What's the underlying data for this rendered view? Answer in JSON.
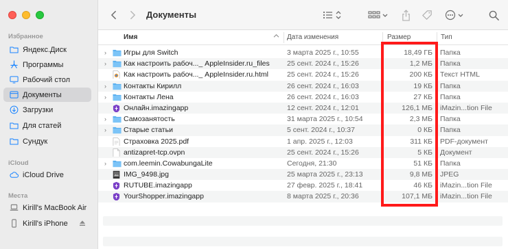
{
  "sidebar": {
    "favorites_label": "Избранное",
    "favorites": [
      {
        "label": "Яндекс.Диск",
        "icon": "folder-icon"
      },
      {
        "label": "Программы",
        "icon": "apps-icon"
      },
      {
        "label": "Рабочий стол",
        "icon": "desktop-icon"
      },
      {
        "label": "Документы",
        "icon": "document-icon",
        "selected": true
      },
      {
        "label": "Загрузки",
        "icon": "download-icon"
      },
      {
        "label": "Для статей",
        "icon": "folder-icon"
      },
      {
        "label": "Сундук",
        "icon": "folder-icon"
      }
    ],
    "icloud_label": "iCloud",
    "icloud": [
      {
        "label": "iCloud Drive",
        "icon": "cloud-icon"
      }
    ],
    "places_label": "Места",
    "places": [
      {
        "label": "Kirill's MacBook Air",
        "icon": "laptop-icon"
      },
      {
        "label": "Kirill's iPhone",
        "icon": "phone-icon"
      }
    ]
  },
  "toolbar": {
    "title": "Документы"
  },
  "columns": {
    "name": "Имя",
    "date": "Дата изменения",
    "size": "Размер",
    "kind": "Тип"
  },
  "files": [
    {
      "name": "Игры для Switch",
      "date": "3 марта 2025 г., 10:55",
      "size": "18,49 ГБ",
      "kind": "Папка",
      "icon": "folder",
      "expandable": true
    },
    {
      "name": "Как настроить рабоч..._ AppleInsider.ru_files",
      "date": "25 сент. 2024 г., 15:26",
      "size": "1,2 МБ",
      "kind": "Папка",
      "icon": "folder",
      "expandable": true
    },
    {
      "name": "Как настроить рабоч..._ AppleInsider.ru.html",
      "date": "25 сент. 2024 г., 15:26",
      "size": "200 КБ",
      "kind": "Текст HTML",
      "icon": "html",
      "expandable": false
    },
    {
      "name": "Контакты Кирилл",
      "date": "26 сент. 2024 г., 16:03",
      "size": "19 КБ",
      "kind": "Папка",
      "icon": "folder",
      "expandable": true
    },
    {
      "name": "Контакты Лена",
      "date": "26 сент. 2024 г., 16:03",
      "size": "27 КБ",
      "kind": "Папка",
      "icon": "folder",
      "expandable": true
    },
    {
      "name": "Онлайн.imazingapp",
      "date": "12 сент. 2024 г., 12:01",
      "size": "126,1 МБ",
      "kind": "iMazin...tion File",
      "icon": "imazing",
      "expandable": false
    },
    {
      "name": "Самозанятость",
      "date": "31 марта 2025 г., 10:54",
      "size": "2,3 МБ",
      "kind": "Папка",
      "icon": "folder",
      "expandable": true
    },
    {
      "name": "Старые статьи",
      "date": "5 сент. 2024 г., 10:37",
      "size": "0 КБ",
      "kind": "Папка",
      "icon": "folder",
      "expandable": true
    },
    {
      "name": "Страховка 2025.pdf",
      "date": "1 апр. 2025 г., 12:03",
      "size": "311 КБ",
      "kind": "PDF-документ",
      "icon": "pdf",
      "expandable": false
    },
    {
      "name": "antizapret-tcp.ovpn",
      "date": "25 сент. 2024 г., 15:26",
      "size": "5 КБ",
      "kind": "Документ",
      "icon": "doc",
      "expandable": false
    },
    {
      "name": "com.leemin.CowabungaLite",
      "date": "Сегодня, 21:30",
      "size": "51 КБ",
      "kind": "Папка",
      "icon": "folder",
      "expandable": true
    },
    {
      "name": "IMG_9498.jpg",
      "date": "25 марта 2025 г., 23:13",
      "size": "9,8 МБ",
      "kind": "JPEG",
      "icon": "image",
      "expandable": false
    },
    {
      "name": "RUTUBE.imazingapp",
      "date": "27 февр. 2025 г., 18:41",
      "size": "46 КБ",
      "kind": "iMazin...tion File",
      "icon": "imazing",
      "expandable": false
    },
    {
      "name": "YourShopper.imazingapp",
      "date": "8 марта 2025 г., 20:36",
      "size": "107,1 МБ",
      "kind": "iMazin...tion File",
      "icon": "imazing",
      "expandable": false
    }
  ],
  "colors": {
    "accent": "#1a84ff",
    "folder": "#5ab0f0",
    "highlight": "#ff1a1a"
  }
}
